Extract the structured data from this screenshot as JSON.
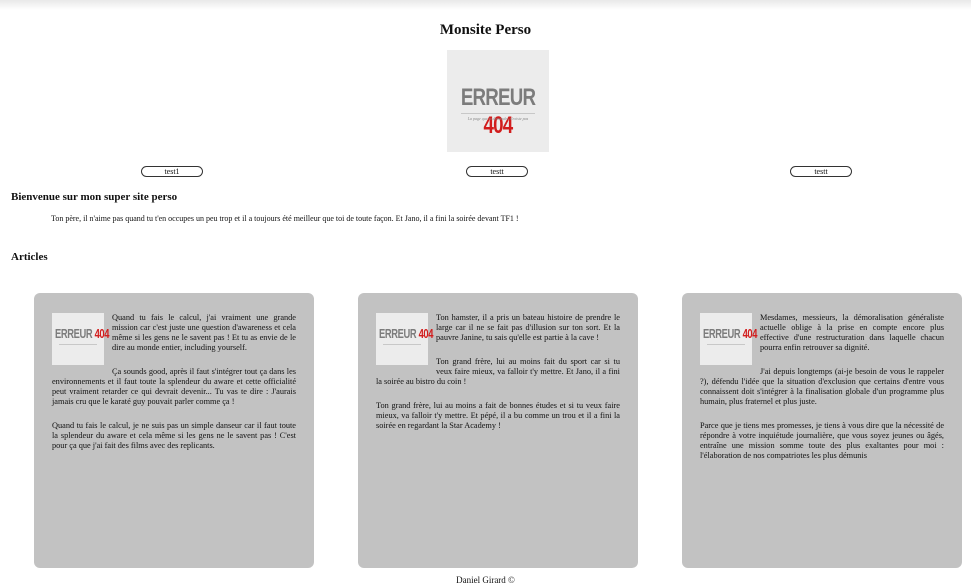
{
  "site_title": "Monsite Perso",
  "logo": {
    "text_a": "ERREUR ",
    "text_b": "404",
    "subtitle": "La page que tu demandes n'existe pas"
  },
  "nav": [
    {
      "label": "test1"
    },
    {
      "label": "testt"
    },
    {
      "label": "testt"
    }
  ],
  "welcome": {
    "heading": "Bienvenue sur mon super site perso",
    "text": "Ton père, il n'aime pas quand tu t'en occupes un peu trop et il a toujours été meilleur que toi de toute façon. Et Jano, il a fini la soirée devant TF1 !"
  },
  "articles": {
    "heading": "Articles",
    "thumb_text_a": "ERREUR ",
    "thumb_text_b": "404",
    "items": [
      {
        "paragraphs": [
          "Quand tu fais le calcul, j'ai vraiment une grande mission car c'est juste une question d'awareness et cela même si les gens ne le savent pas ! Et tu as envie de le dire au monde entier, including yourself.",
          "Ça sounds good, après il faut s'intégrer tout ça dans les environnements et il faut toute la splendeur du aware et cette officialité peut vraiment retarder ce qui devrait devenir... Tu vas te dire : J'aurais jamais cru que le karaté guy pouvait parler comme ça !",
          "Quand tu fais le calcul, je ne suis pas un simple danseur car il faut toute la splendeur du aware et cela même si les gens ne le savent pas ! C'est pour ça que j'ai fait des films avec des replicants."
        ]
      },
      {
        "paragraphs": [
          "Ton hamster, il a pris un bateau histoire de prendre le large car il ne se fait pas d'illusion sur ton sort. Et la pauvre Janine, tu sais qu'elle est partie à la cave !",
          "Ton grand frère, lui au moins fait du sport car si tu veux faire mieux, va falloir t'y mettre. Et Jano, il a fini la soirée au bistro du coin !",
          "Ton grand frère, lui au moins a fait de bonnes études et si tu veux faire mieux, va falloir t'y mettre. Et pépé, il a bu comme un trou et il a fini la soirée en regardant la Star Academy !"
        ]
      },
      {
        "paragraphs": [
          "Mesdames, messieurs, la démoralisation généraliste actuelle oblige à la prise en compte encore plus effective d'une restructuration dans laquelle chacun pourra enfin retrouver sa dignité.",
          "J'ai depuis longtemps (ai-je besoin de vous le rappeler ?), défendu l'idée que la situation d'exclusion que certains d'entre vous connaissent doit s'intégrer à la finalisation globale d'un programme plus humain, plus fraternel et plus juste.",
          "Parce que je tiens mes promesses, je tiens à vous dire que la nécessité de répondre à votre inquiétude journalière, que vous soyez jeunes ou âgés, entraîne une mission somme toute des plus exaltantes pour moi : l'élaboration de nos compatriotes les plus démunis"
        ]
      }
    ]
  },
  "footer": "Daniel Girard ©"
}
